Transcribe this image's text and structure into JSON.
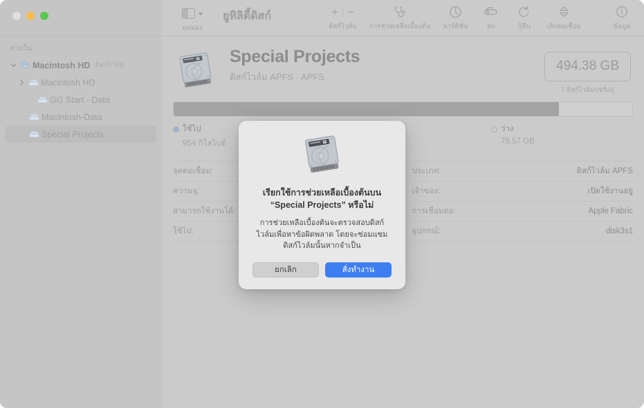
{
  "window": {
    "title": "ยูทิลิตี้ดิสก์",
    "traffic_lights": [
      "close-button",
      "minimize-button",
      "zoom-button"
    ]
  },
  "toolbar": {
    "view_caption": "มุมมอง",
    "view_icon": "sidebar-icon",
    "view_chevron": "chevron-down-icon",
    "items": [
      {
        "icon": "plus-minus-icon",
        "label": "ดิสก์ไวล์ม"
      },
      {
        "icon": "stethoscope-icon",
        "label": "การช่วยเหลือเบื้องต้น"
      },
      {
        "icon": "pie-chart-icon",
        "label": "พาร์ติชั่น"
      },
      {
        "icon": "erase-icon",
        "label": "ลบ"
      },
      {
        "icon": "restore-arrow-icon",
        "label": "กู้คืน"
      },
      {
        "icon": "eject-icon",
        "label": "เลิกต่อเชื่อม"
      },
      {
        "icon": "info-circle-icon",
        "label": "ข้อมูล"
      }
    ],
    "plus_label": "+",
    "minus_label": "−"
  },
  "sidebar": {
    "header": "ภายใน",
    "items": [
      {
        "label": "Macintosh HD",
        "sub": "ดิสก์ไวล์ม",
        "indent": 0,
        "bold": true,
        "disclosure": "chevron-down-icon",
        "selected": false
      },
      {
        "label": "Macintosh HD",
        "sub": "",
        "indent": 1,
        "bold": false,
        "disclosure": "chevron-right-icon",
        "selected": false
      },
      {
        "label": "GG Start - Data",
        "sub": "",
        "indent": 2,
        "bold": false,
        "disclosure": "",
        "selected": false
      },
      {
        "label": "Macintosh-Data",
        "sub": "",
        "indent": 1,
        "bold": false,
        "disclosure": "",
        "selected": false
      },
      {
        "label": "Special Projects",
        "sub": "",
        "indent": 1,
        "bold": false,
        "disclosure": "",
        "selected": true
      }
    ]
  },
  "volume": {
    "icon": "hard-disk-icon",
    "name": "Special Projects",
    "subtitle": "ดิสก์ไวล์ม APFS  ·  APFS",
    "capacity": "494.38 GB",
    "capacity_note": "7 ดิสก์ไวล์มแชร์อยู่"
  },
  "storage": {
    "used_percent": 84,
    "legend": [
      {
        "swatch": "filled",
        "label": "ใช้ไป",
        "value": "954 กิโลไบต์",
        "color": "#9db4c9"
      },
      {
        "swatch": "open",
        "label": "ว่าง",
        "value": "79.57 GB",
        "color": "#b3b3b3"
      }
    ]
  },
  "info": {
    "left": [
      {
        "key": "จุดต่อเชื่อม:",
        "value": ""
      },
      {
        "key": "ความจุ:",
        "value": ""
      },
      {
        "key": "สามารถใช้งานได้:",
        "value": ""
      },
      {
        "key": "ใช้ไป:",
        "value": ""
      }
    ],
    "right": [
      {
        "key": "ประเภท:",
        "value": "ดิสก์ไวล์ม APFS"
      },
      {
        "key": "เจ้าของ:",
        "value": "เปิดใช้งานอยู่"
      },
      {
        "key": "การเชื่อมต่อ:",
        "value": "Apple Fabric"
      },
      {
        "key": "อุปกรณ์:",
        "value": "disk3s1"
      }
    ]
  },
  "dialog": {
    "icon": "hard-disk-icon",
    "title": "เรียกใช้การช่วยเหลือเบื้องต้นบน “Special Projects” หรือไม่",
    "message": "การช่วยเหลือเบื้องต้นจะตรวจสอบดิสก์ไวล์มเพื่อหาข้อผิดพลาด โดยจะซ่อมแซมดิสก์ไวล์มนั้นหากจำเป็น",
    "cancel_label": "ยกเลิก",
    "confirm_label": "สั่งทำงาน",
    "confirm_color": "#3d7ef0"
  }
}
